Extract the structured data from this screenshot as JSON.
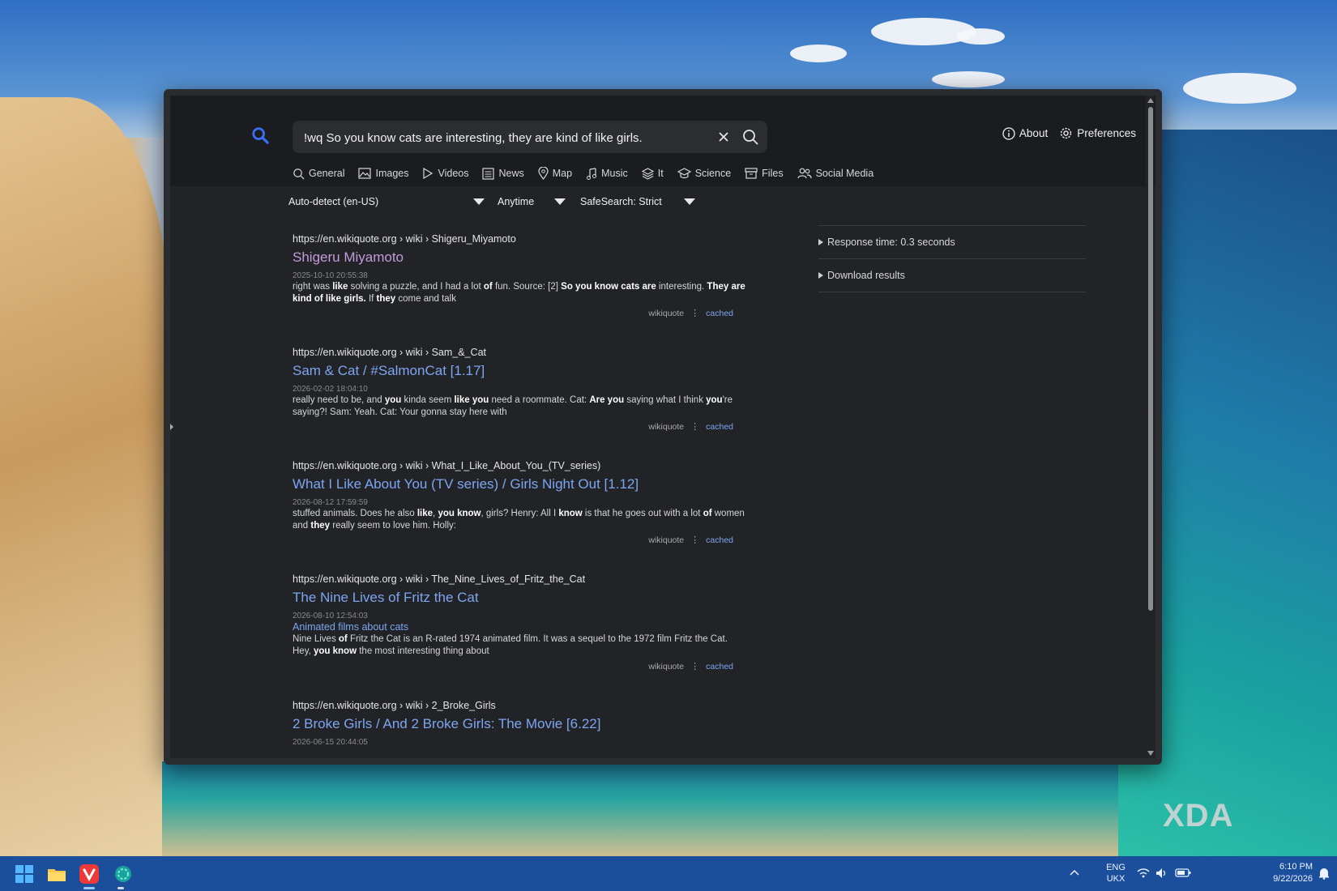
{
  "search": {
    "query": "!wq So you know cats are interesting, they are kind of like girls.",
    "placeholder": ""
  },
  "toplinks": {
    "about": "About",
    "preferences": "Preferences"
  },
  "categories": [
    "General",
    "Images",
    "Videos",
    "News",
    "Map",
    "Music",
    "It",
    "Science",
    "Files",
    "Social Media"
  ],
  "filters": {
    "language": "Auto-detect (en-US)",
    "time": "Anytime",
    "safesearch": "SafeSearch: Strict"
  },
  "results": [
    {
      "url": "https://en.wikiquote.org",
      "path": " › wiki › Shigeru_Miyamoto",
      "title": "Shigeru Miyamoto",
      "date": "2025-10-10 20:55:38",
      "snippet_html": "right was <b>like</b> solving a puzzle, and I had a lot <b>of</b> fun. Source: [2] <b>So you know cats are</b> interesting. <b>They are kind of like girls.</b> If <b>they</b> come and talk",
      "engine": "wikiquote",
      "cached": "cached"
    },
    {
      "url": "https://en.wikiquote.org",
      "path": " › wiki › Sam_&_Cat",
      "title": "Sam & Cat / #SalmonCat [1.17]",
      "date": "2026-02-02 18:04:10",
      "snippet_html": "really need to be, and <b>you</b> kinda seem <b>like you</b> need a roommate. Cat: <b>Are you</b> saying what I think <b>you</b>'re saying?! Sam: Yeah. Cat: Your gonna stay here with",
      "engine": "wikiquote",
      "cached": "cached"
    },
    {
      "url": "https://en.wikiquote.org",
      "path": " › wiki › What_I_Like_About_You_(TV_series)",
      "title": "What I Like About You (TV series) / Girls Night Out [1.12]",
      "date": "2026-08-12 17:59:59",
      "snippet_html": "stuffed animals. Does he also <b>like</b>, <b>you know</b>, girls? Henry: All I <b>know</b> is that he goes out with a lot <b>of</b> women and <b>they</b> really seem to love him. Holly:",
      "engine": "wikiquote",
      "cached": "cached"
    },
    {
      "url": "https://en.wikiquote.org",
      "path": " › wiki › The_Nine_Lives_of_Fritz_the_Cat",
      "title": "The Nine Lives of Fritz the Cat",
      "date": "2026-08-10 12:54:03",
      "category": "Animated films about cats",
      "snippet_html": "Nine Lives <b>of</b> Fritz the Cat is an R-rated 1974 animated film. It was a sequel to the 1972 film Fritz the Cat. Hey, <b>you know</b> the most interesting thing about",
      "engine": "wikiquote",
      "cached": "cached"
    },
    {
      "url": "https://en.wikiquote.org",
      "path": " › wiki › 2_Broke_Girls",
      "title": "2 Broke Girls / And 2 Broke Girls: The Movie [6.22]",
      "date": "2026-06-15 20:44:05"
    }
  ],
  "sidebar": {
    "response_time": "Response time: 0.3 seconds",
    "download": "Download results"
  },
  "taskbar": {
    "lang1": "ENG",
    "lang2": "UKX",
    "time": "6:10 PM",
    "date": "9/22/2026"
  },
  "watermark": "XDA",
  "colors": {
    "link": "#7da6f0",
    "visited": "#c39bdb",
    "page_bg": "#222327",
    "accent": "#3b6ff5"
  }
}
